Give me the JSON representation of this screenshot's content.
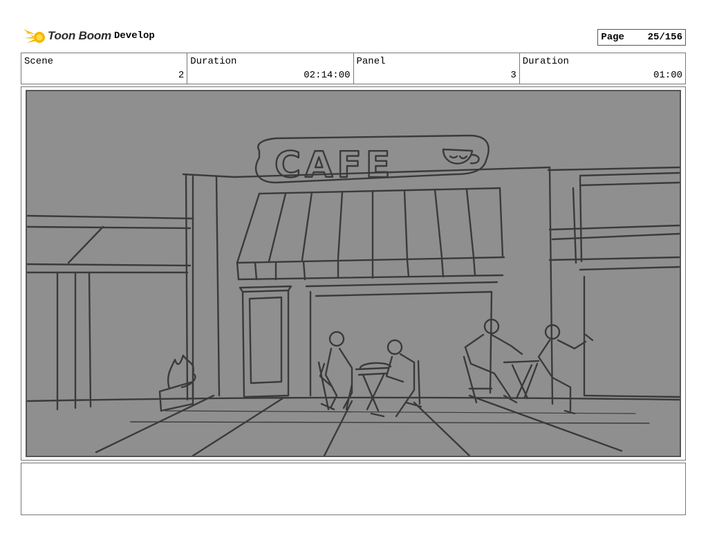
{
  "header": {
    "brand": "Toon Boom",
    "project": "Develop",
    "page_label": "Page",
    "page_value": "25/156"
  },
  "info": {
    "scene_label": "Scene",
    "scene_value": "2",
    "scene_duration_label": "Duration",
    "scene_duration_value": "02:14:00",
    "panel_label": "Panel",
    "panel_value": "3",
    "panel_duration_label": "Duration",
    "panel_duration_value": "01:00"
  },
  "panel": {
    "sign_text": "CAFE"
  },
  "notes": {
    "text": ""
  }
}
